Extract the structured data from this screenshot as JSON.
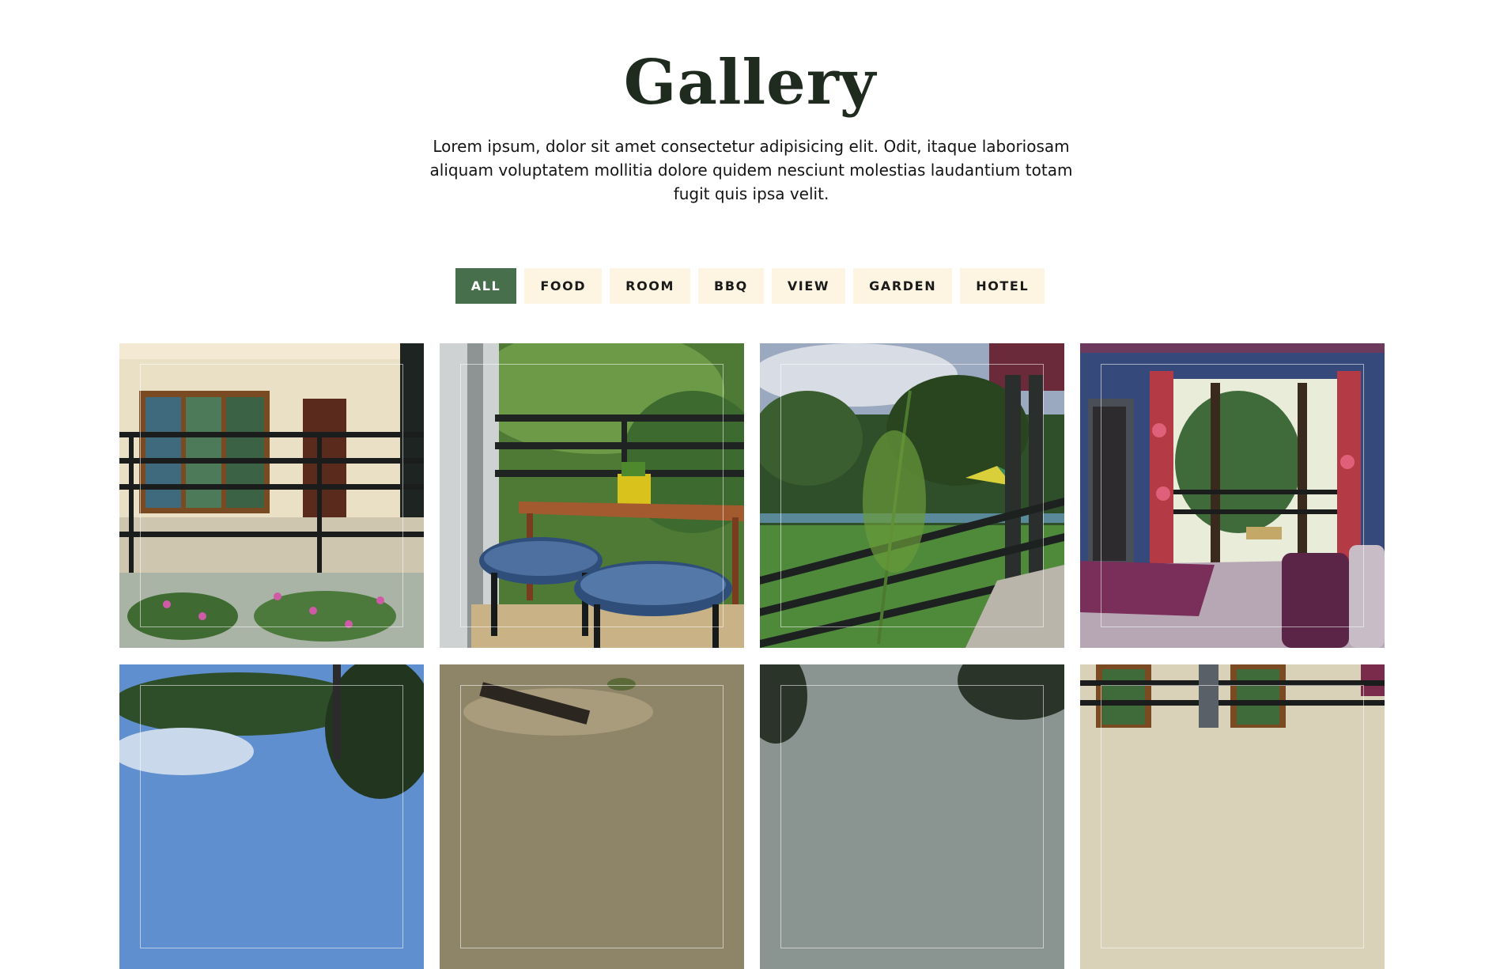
{
  "gallery": {
    "title": "Gallery",
    "description": "Lorem ipsum, dolor sit amet consectetur adipisicing elit. Odit, itaque laboriosam aliquam voluptatem mollitia dolore quidem nesciunt molestias laudantium totam fugit quis ipsa velit."
  },
  "filters": [
    {
      "label": "ALL",
      "active": true
    },
    {
      "label": "FOOD",
      "active": false
    },
    {
      "label": "ROOM",
      "active": false
    },
    {
      "label": "BBQ",
      "active": false
    },
    {
      "label": "VIEW",
      "active": false
    },
    {
      "label": "GARDEN",
      "active": false
    },
    {
      "label": "HOTEL",
      "active": false
    }
  ],
  "colors": {
    "active_filter_bg": "#476f4c",
    "filter_bg": "#fdf5e2",
    "title_color": "#1f2b1f"
  },
  "photos": [
    {
      "subject": "balcony-railing-flowers"
    },
    {
      "subject": "balcony-stools-plant"
    },
    {
      "subject": "garden-view-umbrellas"
    },
    {
      "subject": "bedroom-balcony-door"
    },
    {
      "subject": "trees-sky"
    },
    {
      "subject": "bbq-grill-ground"
    },
    {
      "subject": "evening-landscape"
    },
    {
      "subject": "hotel-exterior-windows"
    }
  ]
}
